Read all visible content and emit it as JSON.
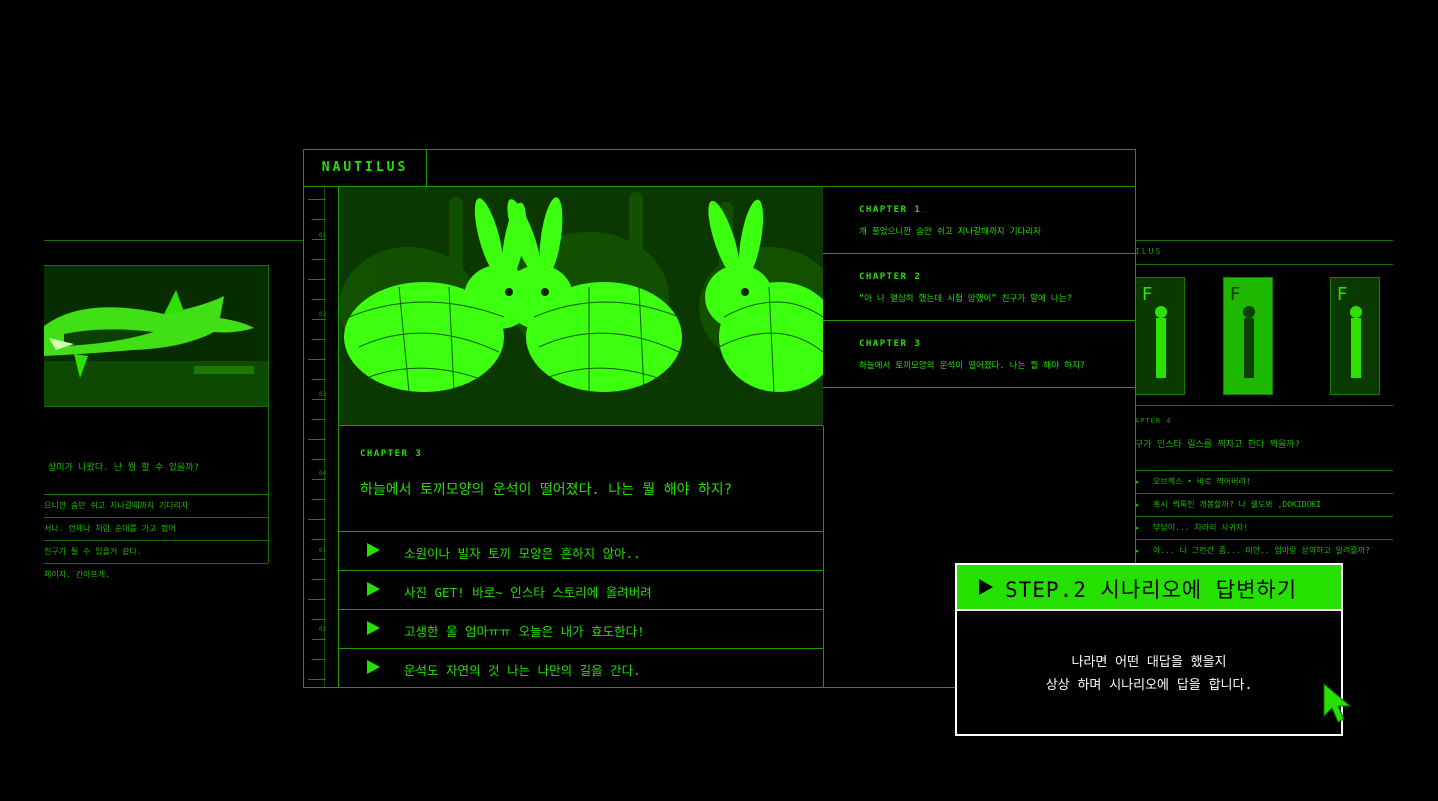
{
  "colors": {
    "accent": "#25e000",
    "background": "#000000",
    "callout_border": "#ffffff"
  },
  "left_window": {
    "image": "shark-image",
    "question": "상미가 나왔다. 난 뭘 할 수 있을까?",
    "options": [
      "으니깐 숨만 쉬고 지나갈때까지 기다리자",
      "서나. 언제나 처럼 순대를 가고 봤어",
      "친구가 될 수 있을거 같다.",
      "체이자. 간아프게."
    ]
  },
  "right_window": {
    "title": "ILUS",
    "chapter": "APTER 4",
    "question": "구가 인스타 릴스를 찍자고 한다 찍을까?",
    "options": [
      "오브젝스 • 바로 찍어버려!",
      "혹시 씩톡인 개봉할까? 나 웰도봐 ,DOKIDOKI",
      "부담이... 차라리 사귀자!",
      "아... 나 그런건 좀... 미안.. 엄마랑 상의하고 알려줄까?"
    ]
  },
  "main": {
    "logo": "NAUTILUS",
    "ruler_labels": [
      "01",
      "02",
      "03",
      "04",
      "01",
      "02"
    ],
    "hero_image": "green-rabbits-image",
    "current_chapter": "CHAPTER 3",
    "question": "하늘에서 토끼모양의 운석이 떨어졌다. 나는 뭘 해야 하지?",
    "options": [
      "소원이나 빌자 토끼 모양은 흔하지 않아..",
      "사진 GET! 바로~ 인스타 스토리에 올려버려",
      "고생한 울 엄마ㅠㅠ 오늘은 내가 효도한다!",
      "운석도 자연의 것 나는 나만의 길을 간다."
    ],
    "chapters": [
      {
        "title": "CHAPTER 1",
        "desc": "개 풀었으니깐 숨만 쉬고 지나갈때까지 기다리자"
      },
      {
        "title": "CHAPTER 2",
        "desc": "“아 나 열심히 했는데 시험 망했어” 친구가 말에 나는?"
      },
      {
        "title": "CHAPTER 3",
        "desc": "하늘에서 토끼모양의 운석이 떨어졌다. 나는 뭘 해야 하지?"
      }
    ]
  },
  "step": {
    "label": "STEP.2 시나리오에 답변하기",
    "line1": "나라면 어떤 대답을 했을지",
    "line2": "상상 하며 시나리오에 답을 합니다."
  },
  "cursor": "pointer-arrow-icon"
}
